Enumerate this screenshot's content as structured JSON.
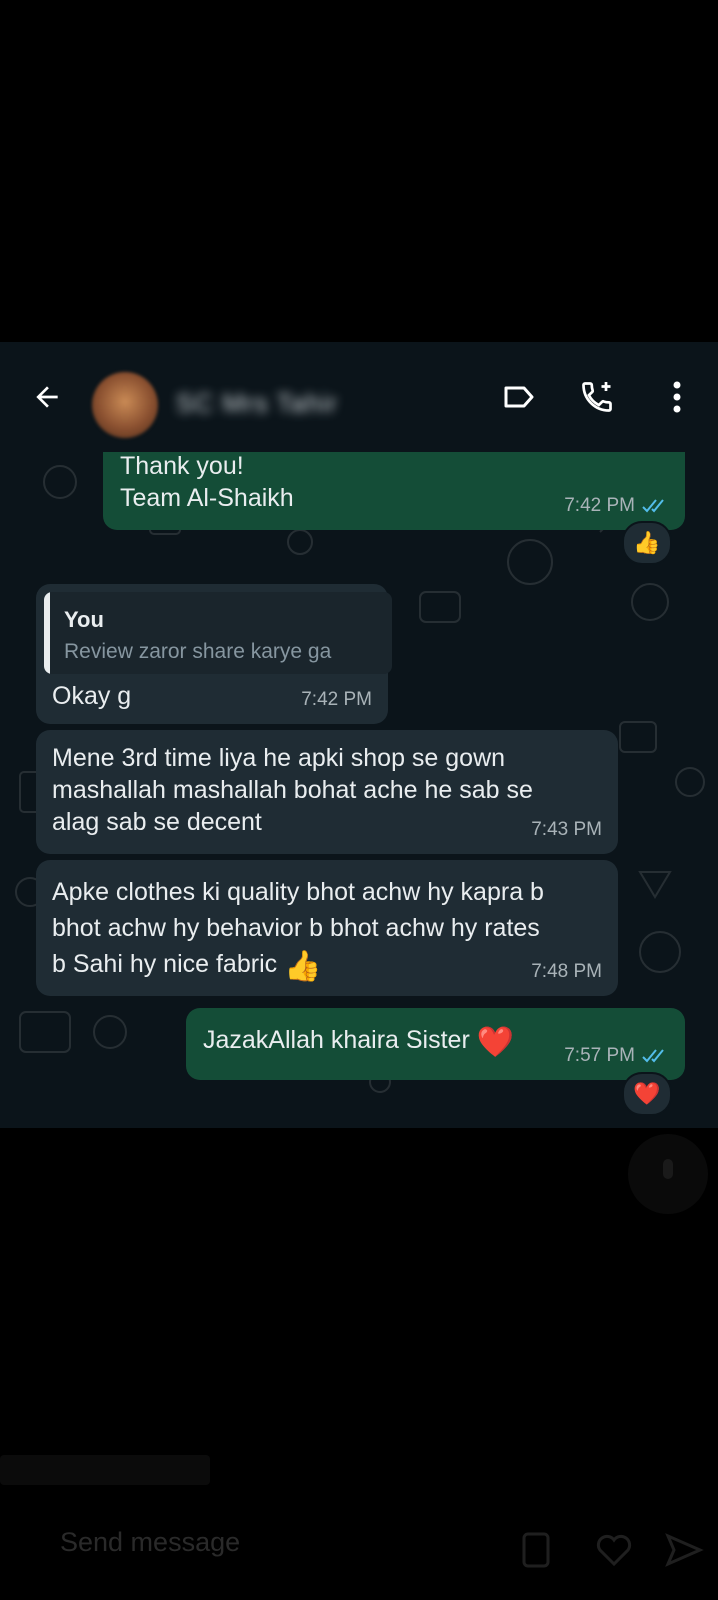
{
  "header": {
    "contact_name": "SC Mrs Tahir",
    "back_icon": "arrow-left-icon",
    "label_icon": "label-icon",
    "call_icon": "add-call-icon",
    "menu_icon": "more-vert-icon"
  },
  "messages": [
    {
      "id": "msg1",
      "direction": "outgoing",
      "text": "Thank you!\nTeam Al-Shaikh",
      "time": "7:42 PM",
      "status": "read",
      "reaction": "👍"
    },
    {
      "id": "msg2",
      "direction": "incoming",
      "quote": {
        "author": "You",
        "text": "Review zaror share karye ga"
      },
      "text": "Okay g",
      "time": "7:42 PM"
    },
    {
      "id": "msg3",
      "direction": "incoming",
      "text": "Mene 3rd time liya he apki shop se gown\nmashallah mashallah bohat ache he sab se\nalag sab se decent",
      "time": "7:43 PM"
    },
    {
      "id": "msg4",
      "direction": "incoming",
      "text": "Apke clothes ki quality bhot achw hy kapra b\nbhot achw hy behavior b bhot achw hy rates\nb Sahi hy nice fabric",
      "emoji": "👍",
      "time": "7:48 PM"
    },
    {
      "id": "msg5",
      "direction": "outgoing",
      "text": "JazakAllah khaira Sister",
      "emoji": "❤️",
      "time": "7:57 PM",
      "status": "read",
      "reaction": "❤️"
    }
  ],
  "composer": {
    "placeholder": "Send message"
  },
  "colors": {
    "outgoing_bubble": "#144d37",
    "incoming_bubble": "#1f2c34",
    "read_ticks": "#53bdeb",
    "chat_background": "#0b141a"
  }
}
